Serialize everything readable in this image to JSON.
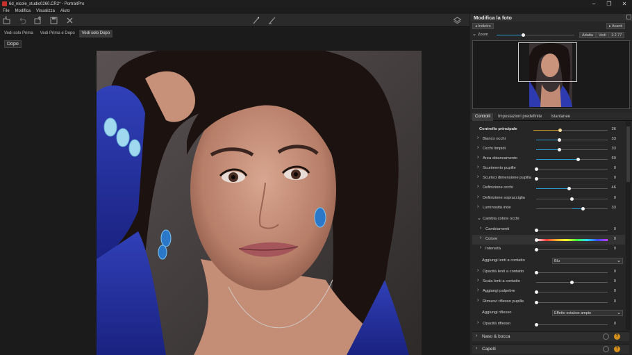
{
  "window": {
    "title": "6d_nicole_studio0260.CR2* - PortraitPro",
    "controls": [
      "–",
      "❐",
      "✕"
    ]
  },
  "menu": [
    "File",
    "Modifica",
    "Visualizza",
    "Aiuto"
  ],
  "view_tabs": [
    "Vedi solo Prima",
    "Vedi Prima e Dopo",
    "Vedi solo Dopo"
  ],
  "active_view_tab": "Vedi solo Dopo",
  "canvas_label": "Dopo",
  "panel": {
    "title": "Modifica la foto",
    "back": "◂ Indietro",
    "forward": "▸ Avanti",
    "zoom_label": "Zoom",
    "zoom_level": 0.35,
    "adatta": "Adatta",
    "vedi": "Vedi",
    "ratio": "1:2.77"
  },
  "panel_tabs": [
    "Controlli",
    "Impostazioni predefinite",
    "Istantanee"
  ],
  "controls": [
    {
      "label": "Controllo principale",
      "value": "36",
      "fraction": 0.36,
      "bold": true,
      "accent": "#d19a26",
      "indent": 0,
      "chevron": ""
    },
    {
      "label": "Bianco occhi",
      "value": "33",
      "fraction": 0.33,
      "indent": 1,
      "chevron": "›"
    },
    {
      "label": "Occhi limpidi",
      "value": "33",
      "fraction": 0.33,
      "indent": 1,
      "chevron": "›"
    },
    {
      "label": "Area sbiancamento",
      "value": "59",
      "fraction": 0.59,
      "indent": 1,
      "chevron": "›"
    },
    {
      "label": "Scurimento pupille",
      "value": "0",
      "fraction": 0.0,
      "indent": 1,
      "chevron": "›"
    },
    {
      "label": "Scurisci dimensione pupilla",
      "value": "0",
      "fraction": 0.0,
      "indent": 1,
      "chevron": "›"
    },
    {
      "label": "Definizione occhi",
      "value": "46",
      "fraction": 0.46,
      "indent": 1,
      "chevron": "›"
    },
    {
      "label": "Definizione sopracciglia",
      "value": "0",
      "fraction": 0.5,
      "indent": 1,
      "chevron": "›",
      "center": true
    },
    {
      "label": "Luminosità iride",
      "value": "33",
      "fraction": 0.66,
      "indent": 1,
      "chevron": "›",
      "center": true
    },
    {
      "label": "Cambia colore occhi",
      "value": "",
      "fraction": null,
      "indent": 1,
      "chevron": "⌄"
    },
    {
      "label": "Cambiamenti",
      "value": "0",
      "fraction": 0.0,
      "indent": 2,
      "chevron": "›"
    },
    {
      "label": "Colore",
      "value": "0",
      "fraction": 0.0,
      "indent": 2,
      "chevron": "›",
      "rainbow": true,
      "highlight": true
    },
    {
      "label": "Intensità",
      "value": "0",
      "fraction": 0.0,
      "indent": 2,
      "chevron": "›"
    },
    {
      "label": "Aggiungi lenti a contatto",
      "value": "",
      "fraction": null,
      "indent": 2,
      "chevron": "",
      "dropdown": "Blu"
    },
    {
      "label": "Opacità lenti a contatto",
      "value": "0",
      "fraction": 0.0,
      "indent": 1,
      "chevron": "›"
    },
    {
      "label": "Scala lenti a contatto",
      "value": "0",
      "fraction": 0.5,
      "indent": 1,
      "chevron": "›",
      "center": true
    },
    {
      "label": "Aggiungi palpebre",
      "value": "0",
      "fraction": 0.0,
      "indent": 1,
      "chevron": "›"
    },
    {
      "label": "Rimuovi riflesso pupille",
      "value": "0",
      "fraction": 0.0,
      "indent": 1,
      "chevron": "›"
    },
    {
      "label": "Aggiungi riflesso",
      "value": "",
      "fraction": null,
      "indent": 2,
      "chevron": "",
      "dropdown": "Effetto octabox ampio"
    },
    {
      "label": "Opacità riflesso",
      "value": "0",
      "fraction": 0.0,
      "indent": 1,
      "chevron": "›"
    }
  ],
  "sections": [
    {
      "label": "Naso & bocca",
      "help": "?"
    },
    {
      "label": "Capelli",
      "help": "?"
    }
  ],
  "colors": {
    "accent_blue": "#2a9bd0",
    "accent_orange": "#d19a26",
    "help_orange": "#d5901b"
  }
}
